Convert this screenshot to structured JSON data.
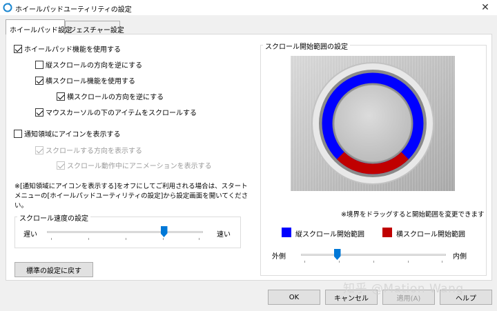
{
  "window": {
    "title": "ホイールパッドユーティリティの設定",
    "close_glyph": "✕"
  },
  "tabs": [
    {
      "label": "ホイールパッド設定",
      "active": true
    },
    {
      "label": "ジェスチャー設定",
      "active": false
    }
  ],
  "options": {
    "enable_wheel": {
      "label": "ホイールパッド機能を使用する",
      "checked": true
    },
    "invert_vertical": {
      "label": "縦スクロールの方向を逆にする",
      "checked": false
    },
    "enable_horizontal": {
      "label": "横スクロール機能を使用する",
      "checked": true
    },
    "invert_horizontal": {
      "label": "横スクロールの方向を逆にする",
      "checked": true
    },
    "scroll_under_cursor": {
      "label": "マウスカーソルの下のアイテムをスクロールする",
      "checked": true
    },
    "show_tray_icon": {
      "label": "通知領域にアイコンを表示する",
      "checked": false
    },
    "show_direction": {
      "label": "スクロールする方向を表示する",
      "checked": true,
      "disabled": true
    },
    "show_animation": {
      "label": "スクロール動作中にアニメーションを表示する",
      "checked": true,
      "disabled": true
    }
  },
  "note": "※[通知領域にアイコンを表示する]をオフにしてご利用される場合は、スタートメニューの[ホイールパッドユーティリティの設定]から設定画面を開いてください。",
  "speed": {
    "title": "スクロール速度の設定",
    "slow_label": "遅い",
    "fast_label": "速い",
    "value_fraction": 0.75
  },
  "reset_button": "標準の設定に戻す",
  "scroll_range": {
    "title": "スクロール開始範囲の設定",
    "hint": "※境界をドラッグすると開始範囲を変更できます",
    "legend_vertical": "縦スクロール開始範囲",
    "legend_horizontal": "横スクロール開始範囲",
    "outer_label": "外側",
    "inner_label": "内側",
    "value_fraction": 0.25,
    "vertical_color": "#0000ff",
    "horizontal_color": "#c00000"
  },
  "buttons": {
    "ok": "OK",
    "cancel": "キャンセル",
    "apply": "適用(A)",
    "help": "ヘルプ"
  },
  "watermark": "知乎 @Mation Wang"
}
